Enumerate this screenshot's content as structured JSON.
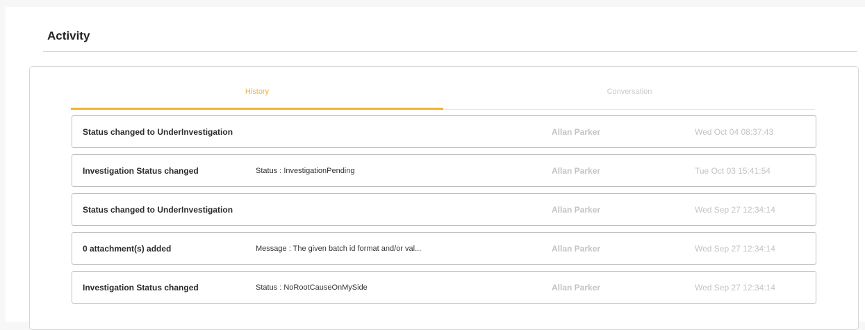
{
  "section": {
    "title": "Activity"
  },
  "tabs": [
    {
      "label": "History",
      "active": true
    },
    {
      "label": "Conversation",
      "active": false
    }
  ],
  "history": [
    {
      "title": "Status changed to UnderInvestigation",
      "detail": "",
      "user": "Allan Parker",
      "time": "Wed Oct 04 08:37:43"
    },
    {
      "title": "Investigation Status changed",
      "detail": "Status : InvestigationPending",
      "user": "Allan Parker",
      "time": "Tue Oct 03 15:41:54"
    },
    {
      "title": "Status changed to UnderInvestigation",
      "detail": "",
      "user": "Allan Parker",
      "time": "Wed Sep 27 12:34:14"
    },
    {
      "title": "0 attachment(s) added",
      "detail": "Message : The given batch id format and/or val...",
      "user": "Allan Parker",
      "time": "Wed Sep 27 12:34:14"
    },
    {
      "title": "Investigation Status changed",
      "detail": "Status : NoRootCauseOnMySide",
      "user": "Allan Parker",
      "time": "Wed Sep 27 12:34:14"
    }
  ],
  "colors": {
    "accent": "#f2b233",
    "muted": "#c3c3c3",
    "border": "#bfbfbf"
  }
}
